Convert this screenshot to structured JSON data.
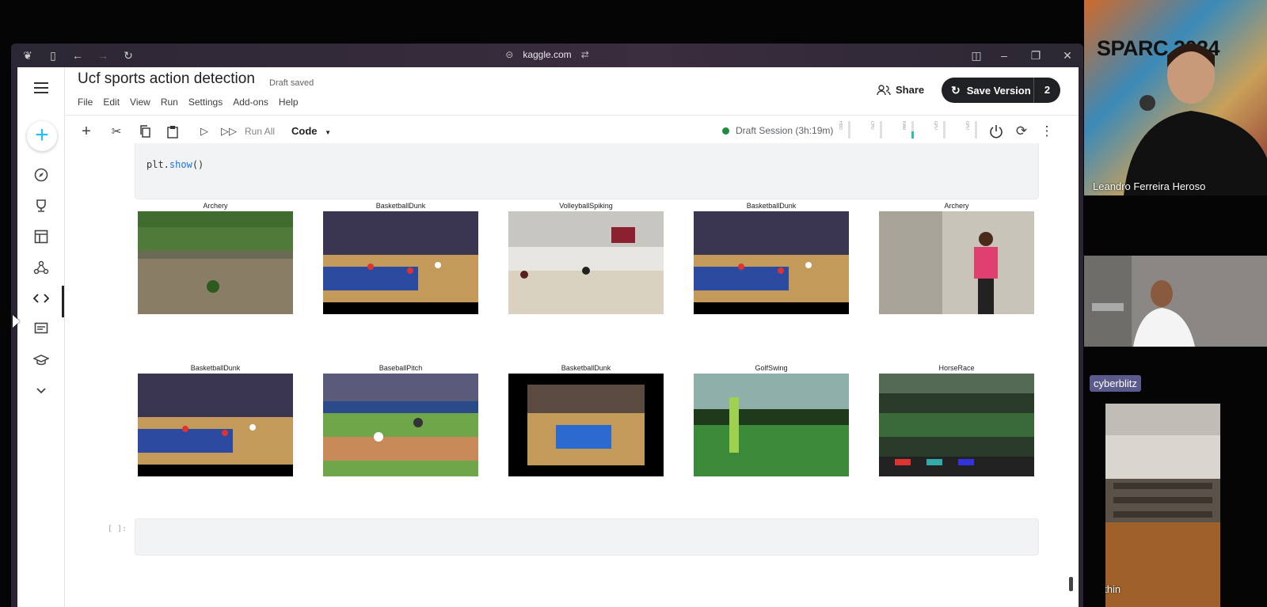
{
  "browser": {
    "url": "kaggle.com"
  },
  "notebook": {
    "title": "Ucf sports action detection",
    "draft_status": "Draft saved",
    "menu": [
      "File",
      "Edit",
      "View",
      "Run",
      "Settings",
      "Add-ons",
      "Help"
    ],
    "share_label": "Share",
    "save_label": "Save Version",
    "save_count": "2"
  },
  "toolbar": {
    "run_all": "Run All",
    "cell_type": "Code",
    "session": "Draft Session (3h:19m)",
    "meters": [
      "HDD",
      "CPU",
      "RAM",
      "GPU",
      "GPU"
    ],
    "ram_level": 0.45
  },
  "code_cell": {
    "prefix": "plt.",
    "fn": "show",
    "suffix": "()"
  },
  "images": [
    {
      "label": "Archery",
      "scene": "forest"
    },
    {
      "label": "BasketballDunk",
      "scene": "court"
    },
    {
      "label": "VolleyballSpiking",
      "scene": "gym"
    },
    {
      "label": "BasketballDunk",
      "scene": "court"
    },
    {
      "label": "Archery",
      "scene": "indoor"
    },
    {
      "label": "BasketballDunk",
      "scene": "court"
    },
    {
      "label": "BaseballPitch",
      "scene": "baseball"
    },
    {
      "label": "BasketballDunk",
      "scene": "court-dark"
    },
    {
      "label": "GolfSwing",
      "scene": "golf"
    },
    {
      "label": "HorseRace",
      "scene": "race"
    }
  ],
  "empty_cell_prompt": "[ ]:",
  "video_call": {
    "participant_1": "Leandro Ferreira Heroso",
    "participant_2_tag": "cyberblitz",
    "participant_3": "nithin",
    "banner_text": "SPARC 2024"
  },
  "colors": {
    "kaggle_blue": "#20beff",
    "session_green": "#1e8e3e",
    "save_bg": "#202124"
  }
}
